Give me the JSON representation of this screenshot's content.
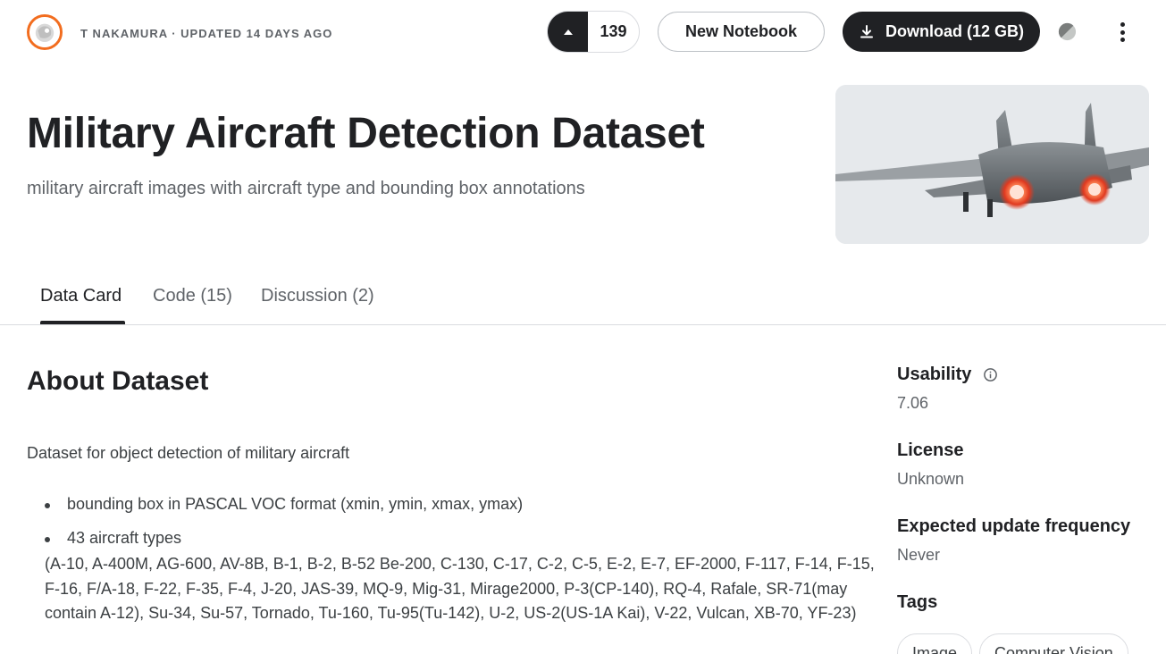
{
  "header": {
    "author_line": "T NAKAMURA · UPDATED 14 DAYS AGO",
    "vote_count": "139",
    "new_notebook_label": "New Notebook",
    "download_label": "Download (12 GB)",
    "accent_color": "#f26d1f",
    "primary_dark": "#202124"
  },
  "dataset": {
    "title": "Military Aircraft Detection Dataset",
    "subtitle": "military aircraft images with aircraft type and bounding box annotations"
  },
  "tabs": [
    {
      "label": "Data Card",
      "active": true
    },
    {
      "label": "Code (15)",
      "active": false
    },
    {
      "label": "Discussion (2)",
      "active": false
    }
  ],
  "about": {
    "heading": "About Dataset",
    "intro": "Dataset for object detection of military aircraft",
    "bullets": [
      "bounding box in PASCAL VOC format (xmin, ymin, xmax, ymax)",
      "43 aircraft types"
    ],
    "types_text": "(A-10, A-400M, AG-600, AV-8B, B-1, B-2, B-52 Be-200, C-130, C-17, C-2, C-5, E-2, E-7, EF-2000, F-117, F-14, F-15, F-16, F/A-18, F-22, F-35, F-4, J-20, JAS-39, MQ-9, Mig-31, Mirage2000, P-3(CP-140), RQ-4, Rafale, SR-71(may contain A-12), Su-34, Su-57, Tornado, Tu-160, Tu-95(Tu-142), U-2, US-2(US-1A Kai), V-22, Vulcan, XB-70, YF-23)"
  },
  "sidebar": {
    "usability_label": "Usability",
    "usability_value": "7.06",
    "license_label": "License",
    "license_value": "Unknown",
    "frequency_label": "Expected update frequency",
    "frequency_value": "Never",
    "tags_label": "Tags",
    "tags": [
      "Image",
      "Computer Vision"
    ]
  },
  "icons": {
    "vote": "triangle-up-icon",
    "download": "download-icon",
    "theme": "half-circle-theme-icon",
    "more": "vertical-dots-icon",
    "info": "info-icon"
  }
}
